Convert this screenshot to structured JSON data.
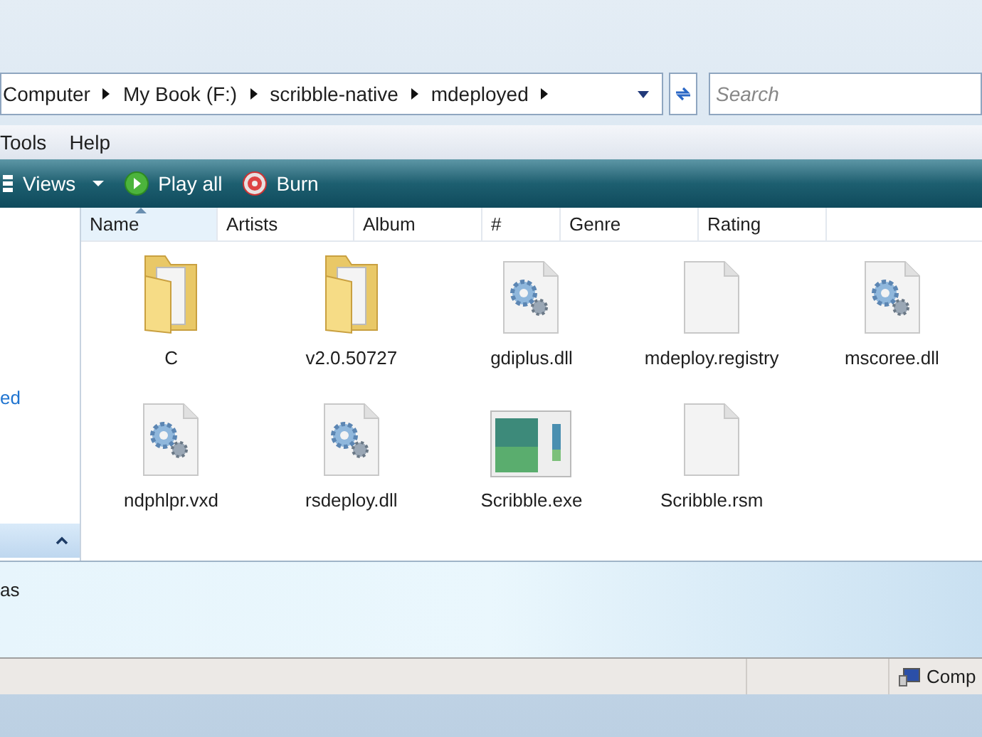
{
  "address": {
    "crumbs": [
      "Computer",
      "My Book (F:)",
      "scribble-native",
      "mdeployed"
    ]
  },
  "search": {
    "placeholder": "Search"
  },
  "menu": [
    "Tools",
    "Help"
  ],
  "toolbar": [
    {
      "label": "Views",
      "kind": "views"
    },
    {
      "label": "Play all",
      "kind": "play"
    },
    {
      "label": "Burn",
      "kind": "burn"
    }
  ],
  "columns": [
    {
      "label": "Name",
      "sorted": true
    },
    {
      "label": "Artists",
      "sorted": false
    },
    {
      "label": "Album",
      "sorted": false
    },
    {
      "label": "#",
      "sorted": false
    },
    {
      "label": "Genre",
      "sorted": false
    },
    {
      "label": "Rating",
      "sorted": false
    }
  ],
  "left_pane": {
    "link": "ed"
  },
  "files": [
    {
      "name": "C",
      "kind": "folder"
    },
    {
      "name": "v2.0.50727",
      "kind": "folder"
    },
    {
      "name": "gdiplus.dll",
      "kind": "system"
    },
    {
      "name": "mdeploy.registry",
      "kind": "blank"
    },
    {
      "name": "mscoree.dll",
      "kind": "system"
    },
    {
      "name": "ndphlpr.vxd",
      "kind": "system"
    },
    {
      "name": "rsdeploy.dll",
      "kind": "system"
    },
    {
      "name": "Scribble.exe",
      "kind": "app"
    },
    {
      "name": "Scribble.rsm",
      "kind": "blank"
    }
  ],
  "details": {
    "text": "as"
  },
  "status_bar": {
    "location": "Comp"
  }
}
